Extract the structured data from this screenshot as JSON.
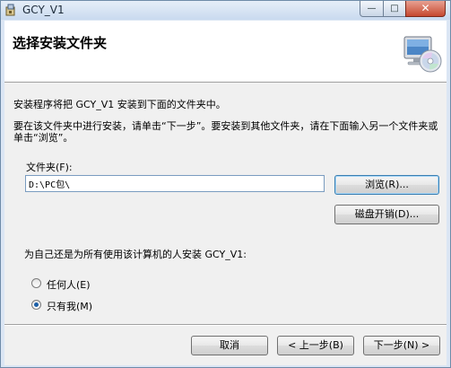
{
  "window": {
    "title": "GCY_V1",
    "min_glyph": "—",
    "max_glyph": "□",
    "close_glyph": "✕",
    "app_icon": "installer-icon"
  },
  "banner": {
    "title": "选择安装文件夹",
    "icon": "computer-cd-icon"
  },
  "text": {
    "intro": "安装程序将把 GCY_V1 安装到下面的文件夹中。",
    "instructions": "要在该文件夹中进行安装，请单击“下一步”。要安装到其他文件夹，请在下面输入另一个文件夹或单击“浏览”。",
    "folder_label": "文件夹(F):",
    "who_question": "为自己还是为所有使用该计算机的人安装 GCY_V1:"
  },
  "folder": {
    "value": "D:\\PC包\\"
  },
  "buttons": {
    "browse": "浏览(R)...",
    "disk_cost": "磁盘开销(D)...",
    "cancel": "取消",
    "prev": "< 上一步(B)",
    "next": "下一步(N) >"
  },
  "radios": [
    {
      "label": "任何人(E)",
      "checked": false
    },
    {
      "label": "只有我(M)",
      "checked": true
    }
  ],
  "colors": {
    "accent": "#1c5fa8",
    "banner_bg": "#ffffff",
    "dialog_bg": "#f0f0f0"
  }
}
